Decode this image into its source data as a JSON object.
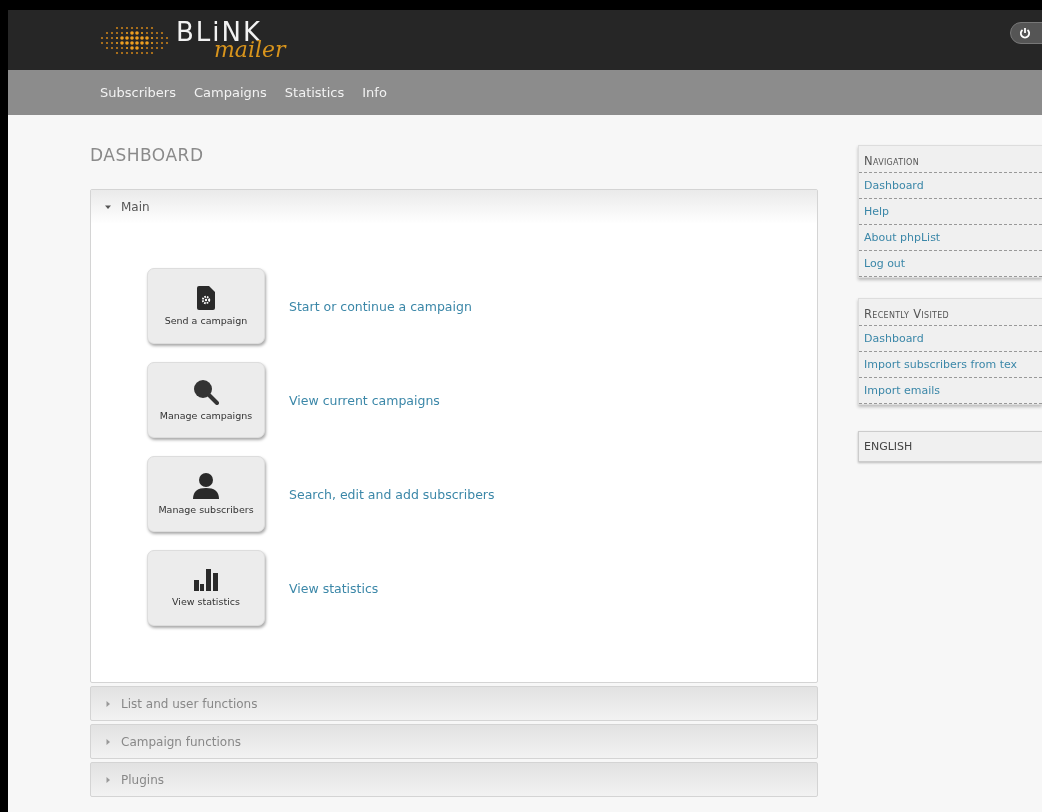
{
  "logo": {
    "title": "BLiNK",
    "subtitle": "mailer"
  },
  "menu": [
    {
      "label": "Subscribers"
    },
    {
      "label": "Campaigns"
    },
    {
      "label": "Statistics"
    },
    {
      "label": "Info"
    }
  ],
  "page_title": "DASHBOARD",
  "sections": [
    {
      "title": "Main",
      "expanded": true,
      "actions": [
        {
          "kind": "campaign",
          "button": "Send a campaign",
          "link": "Start or continue a campaign"
        },
        {
          "kind": "search",
          "button": "Manage campaigns",
          "link": "View current campaigns"
        },
        {
          "kind": "user",
          "button": "Manage subscribers",
          "link": "Search, edit and add subscribers"
        },
        {
          "kind": "stats",
          "button": "View statistics",
          "link": "View statistics"
        }
      ]
    },
    {
      "title": "List and user functions",
      "expanded": false
    },
    {
      "title": "Campaign functions",
      "expanded": false
    },
    {
      "title": "Plugins",
      "expanded": false
    }
  ],
  "sidebar": [
    {
      "title": "Navigation",
      "items": [
        "Dashboard",
        "Help",
        "About phpList",
        "Log out"
      ]
    },
    {
      "title": "Recently Visited",
      "items": [
        "Dashboard",
        "Import subscribers from tex",
        "Import emails"
      ]
    }
  ],
  "language": "ENGLISH"
}
